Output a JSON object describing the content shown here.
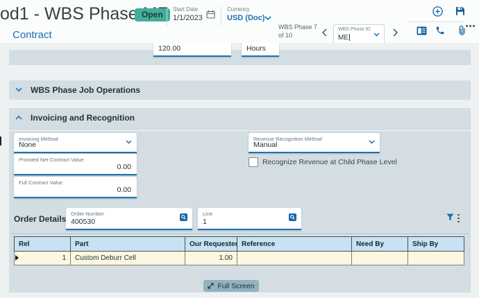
{
  "colors": {
    "accent_blue": "#1b6fb5",
    "badge_teal": "#43ae9b",
    "panel_bg": "#d4dee2",
    "table_header_bg": "#c7e2f2",
    "table_row_bg": "#fbf7e1",
    "full_screen_button_bg": "#91b2bf"
  },
  "icons": {
    "calendar": "calendar-icon",
    "add": "plus-circle-icon",
    "save": "save-icon",
    "overflow": "ellipsis-icon",
    "contact_card": "contact-card-icon",
    "phone": "phone-icon",
    "attachment": "paperclip-icon",
    "search": "search-icon",
    "filter": "filter-funnel-icon",
    "expand": "expand-icon"
  },
  "header": {
    "title": "od1 - WBS Phase ME",
    "status_badge": "Open",
    "start_date": {
      "label": "Start Date",
      "value": "1/1/2023"
    },
    "currency": {
      "label": "Currency",
      "value": "USD (Doc)"
    },
    "tab_contract": "Contract",
    "phase_nav": {
      "counter": "WBS Phase 7 of 10",
      "field_label": "WBS Phase ID",
      "field_value": "ME"
    }
  },
  "scrolled_row": {
    "value_amount": "120.00",
    "value_unit": "Hours"
  },
  "sections": {
    "job_operations": {
      "title": "WBS Phase Job Operations"
    },
    "invoicing": {
      "title": "Invoicing and Recognition",
      "invoicing_method": {
        "label": "Invoicing Method",
        "value": "None"
      },
      "revenue_recognition_method": {
        "label": "Revenue Recognition Method",
        "value": "Manual"
      },
      "prorated_net_contract_value": {
        "label": "Prorated Net Contract Value",
        "value": "0.00"
      },
      "full_contract_value": {
        "label": "Full Contract Value",
        "value": "0.00"
      },
      "recognize_revenue_checkbox": {
        "label": "Recognize Revenue at Child Phase Level",
        "checked": false
      }
    },
    "order_details": {
      "title": "Order Details",
      "order_number": {
        "label": "Order Number",
        "value": "400530"
      },
      "line": {
        "label": "Line",
        "value": "1"
      },
      "table": {
        "columns": [
          "Rel",
          "Part",
          "Our Requested Qty",
          "Reference",
          "Need By",
          "Ship By"
        ],
        "rows": [
          {
            "rel": "1",
            "part": "Custom Deburr Cell",
            "qty": "1.00",
            "reference": "",
            "need_by": "",
            "ship_by": ""
          }
        ]
      }
    }
  },
  "footer": {
    "full_screen_label": "Full Screen"
  }
}
